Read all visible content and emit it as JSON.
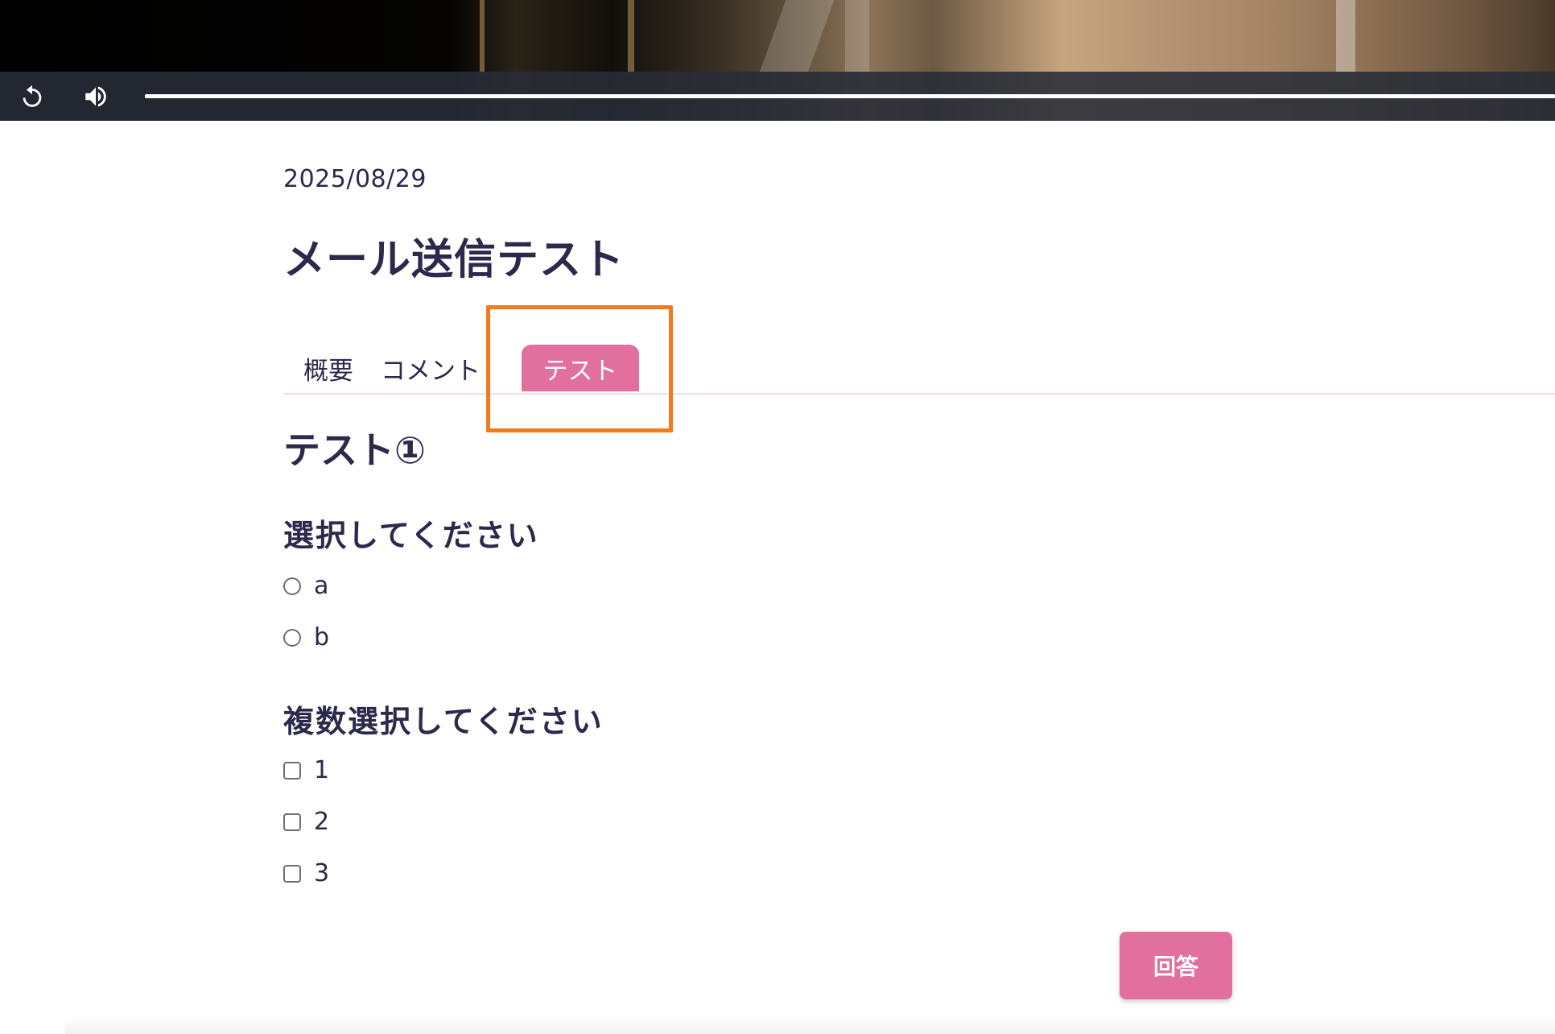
{
  "video": {
    "progress": 1.0,
    "controls": {
      "replay_icon": "replay-icon",
      "volume_icon": "volume-icon"
    }
  },
  "lesson": {
    "date": "2025/08/29",
    "title": "メール送信テスト"
  },
  "tabs": [
    {
      "label": "概要",
      "active": false
    },
    {
      "label": "コメント",
      "active": false
    },
    {
      "label": "テスト",
      "active": true
    }
  ],
  "test": {
    "title": "テスト①",
    "questions": [
      {
        "prompt": "選択してください",
        "type": "radio",
        "options": [
          "a",
          "b"
        ]
      },
      {
        "prompt": "複数選択してください",
        "type": "checkbox",
        "options": [
          "1",
          "2",
          "3"
        ]
      }
    ],
    "submit_label": "回答"
  },
  "colors": {
    "accent": "#e1709f",
    "highlight": "#f27a1a",
    "text": "#2b2a4c"
  }
}
